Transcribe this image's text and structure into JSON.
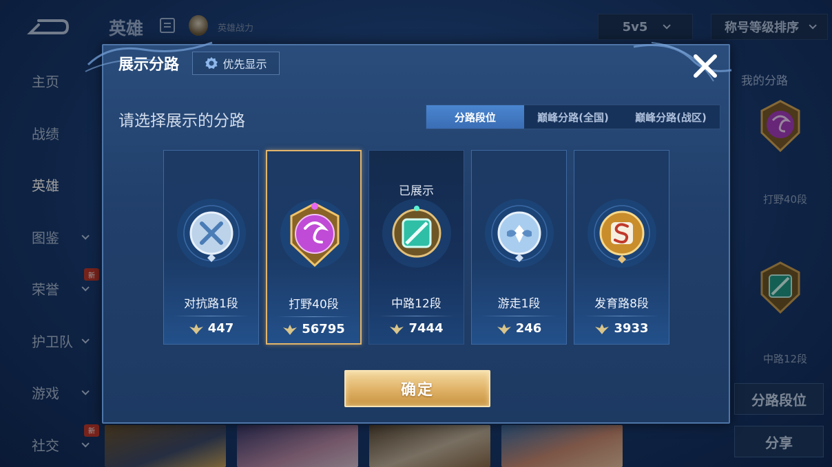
{
  "background": {
    "title": "英雄",
    "hero_power_label": "英雄战力",
    "mode_select": "5v5",
    "sort_select": "称号等级排序",
    "nav": [
      {
        "label": "主页",
        "has_chevron": false,
        "badge": ""
      },
      {
        "label": "战绩",
        "has_chevron": false,
        "badge": ""
      },
      {
        "label": "英雄",
        "has_chevron": false,
        "badge": "",
        "active": true
      },
      {
        "label": "图鉴",
        "has_chevron": true,
        "badge": ""
      },
      {
        "label": "荣誉",
        "has_chevron": true,
        "badge": "新"
      },
      {
        "label": "护卫队",
        "has_chevron": true,
        "badge": ""
      },
      {
        "label": "游戏",
        "has_chevron": true,
        "badge": ""
      },
      {
        "label": "社交",
        "has_chevron": true,
        "badge": "新"
      }
    ],
    "right_panel": {
      "title": "我的分路",
      "lane1_label": "打野40段",
      "lane2_label": "中路12段",
      "lane_rank_button": "分路段位",
      "share_button": "分享"
    }
  },
  "dialog": {
    "title": "展示分路",
    "priority_button": "优先显示",
    "prompt": "请选择展示的分路",
    "tabs": [
      "分路段位",
      "巅峰分路(全国)",
      "巅峰分路(战区)"
    ],
    "active_tab": 0,
    "cards": [
      {
        "label": "对抗路1段",
        "score": "447",
        "shown_text": "",
        "selected": false,
        "emblem": "crossed-swords",
        "color": "#9fc3e6"
      },
      {
        "label": "打野40段",
        "score": "56795",
        "shown_text": "",
        "selected": true,
        "emblem": "dragon",
        "color": "#c04bd6"
      },
      {
        "label": "中路12段",
        "score": "7444",
        "shown_text": "已展示",
        "selected": false,
        "emblem": "staff",
        "color": "#2fbfa6"
      },
      {
        "label": "游走1段",
        "score": "246",
        "shown_text": "",
        "selected": false,
        "emblem": "wings",
        "color": "#a9cdee"
      },
      {
        "label": "发育路8段",
        "score": "3933",
        "shown_text": "",
        "selected": false,
        "emblem": "s-mark",
        "color": "#e3a43a"
      }
    ],
    "confirm_button": "确定"
  },
  "colors": {
    "accent_gold": "#e2b56a",
    "tab_active": "#3a6db4",
    "dialog_bg": "#213f6a"
  }
}
